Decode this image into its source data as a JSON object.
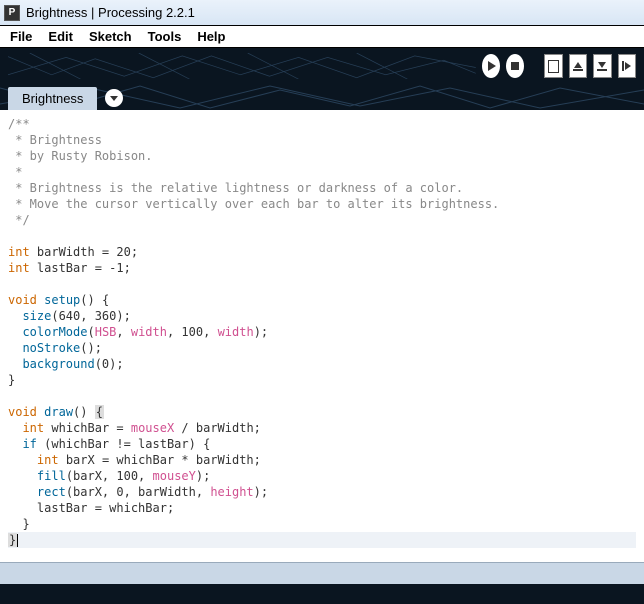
{
  "window": {
    "title": "Brightness | Processing 2.2.1",
    "icon_letter": "P"
  },
  "menu": {
    "file": "File",
    "edit": "Edit",
    "sketch": "Sketch",
    "tools": "Tools",
    "help": "Help"
  },
  "tabs": {
    "active": "Brightness"
  },
  "code": {
    "c1": "/**",
    "c2": " * Brightness",
    "c3": " * by Rusty Robison.  ",
    "c4": " * ",
    "c5": " * Brightness is the relative lightness or darkness of a color. ",
    "c6": " * Move the cursor vertically over each bar to alter its brightness. ",
    "c7": " */",
    "kw_int": "int",
    "kw_void": "void",
    "kw_if": "if",
    "fn_setup": "setup",
    "fn_draw": "draw",
    "fn_size": "size",
    "fn_colorMode": "colorMode",
    "fn_noStroke": "noStroke",
    "fn_background": "background",
    "fn_fill": "fill",
    "fn_rect": "rect",
    "bi_HSB": "HSB",
    "bi_width": "width",
    "bi_height": "height",
    "bi_mouseX": "mouseX",
    "bi_mouseY": "mouseY",
    "v_barWidth": " barWidth = 20;",
    "v_lastBar": " lastBar = -1;",
    "p_oc": "() {",
    "p_ob": "() ",
    "p_ob2": " {",
    "t_size_args": "(640, 360);",
    "t_cm_open": "(",
    "t_cm_mid1": ", ",
    "t_cm_mid2": ", 100, ",
    "t_cm_end": ");",
    "t_ns": "();",
    "t_bg": "(0);",
    "t_close": "}",
    "t_wb": " whichBar = ",
    "t_wb2": " / barWidth;",
    "t_if": " (whichBar != lastBar) {",
    "t_bx": " barX = whichBar * barWidth;",
    "t_fill_o": "(barX, 100, ",
    "t_fill_c": ");",
    "t_rect_o": "(barX, 0, barWidth, ",
    "t_rect_c": ");",
    "t_lb": "lastBar = whichBar;",
    "sp2": "  ",
    "sp4": "    ",
    "brace_o": "{",
    "brace_c": "}"
  }
}
